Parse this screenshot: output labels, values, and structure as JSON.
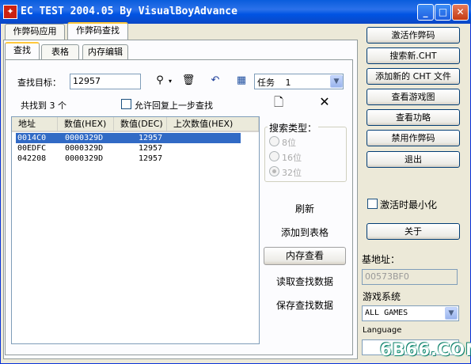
{
  "window": {
    "title": "EC TEST 2004.05  By VisualBoyAdvance",
    "controls": {
      "minimize": "_",
      "maximize": "□",
      "close": "✕"
    }
  },
  "top_tabs": [
    "作弊码应用",
    "作弊码查找"
  ],
  "sub_tabs": [
    "查找",
    "表格",
    "内存编辑"
  ],
  "search": {
    "target_label": "查找目标：",
    "target_value": "12957",
    "task_label": "任务",
    "task_value": "1",
    "found_text": "共找到 3 个",
    "allow_undo_label": "允许回复上一步查找"
  },
  "results": {
    "columns": [
      "地址",
      "数值(HEX)",
      "数值(DEC)",
      "上次数值(HEX)"
    ],
    "rows": [
      {
        "address": "0014C0",
        "hex": "0000329D",
        "dec": "12957",
        "selected": true
      },
      {
        "address": "00EDFC",
        "hex": "0000329D",
        "dec": "12957",
        "selected": false
      },
      {
        "address": "042208",
        "hex": "0000329D",
        "dec": "12957",
        "selected": false
      }
    ]
  },
  "search_type": {
    "title": "搜索类型：",
    "options": [
      "8位",
      "16位",
      "32位"
    ],
    "selected": "32位"
  },
  "actions": {
    "refresh": "刷新",
    "add_to_table": "添加到表格",
    "memory_view": "内存查看",
    "load_search_data": "读取查找数据",
    "save_search_data": "保存查找数据"
  },
  "right_buttons": [
    "激活作弊码",
    "搜索新.CHT",
    "添加新的 CHT 文件",
    "查看游戏图",
    "查看功略",
    "禁用作弊码",
    "退出"
  ],
  "minimize_on_activate": "激活时最小化",
  "about_button": "关于",
  "base_address": {
    "label": "基地址：",
    "value": "00573BF0"
  },
  "game_system": {
    "label": "游戏系统",
    "value": "ALL GAMES"
  },
  "language": {
    "label": "Language"
  },
  "watermark": "6B66.COM"
}
